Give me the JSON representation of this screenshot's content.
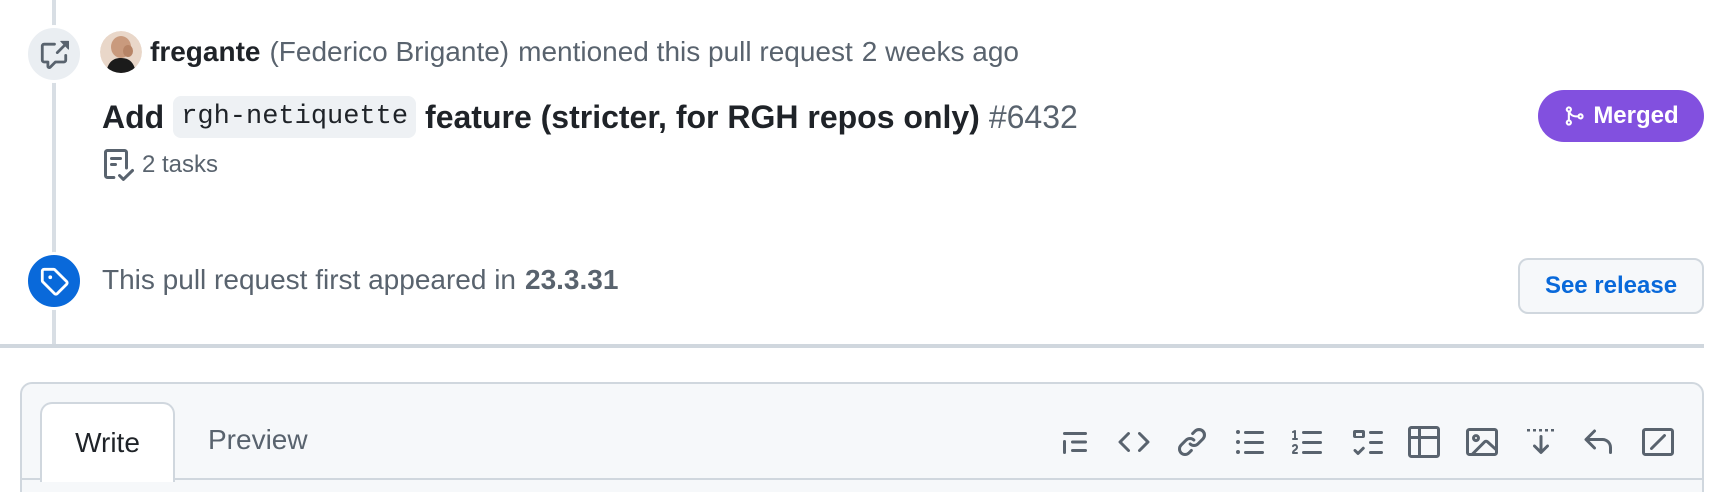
{
  "event": {
    "author": "fregante",
    "full_name": "(Federico Brigante)",
    "action": "mentioned this pull request",
    "time": "2 weeks ago"
  },
  "pull_request": {
    "title_prefix": "Add",
    "title_code": "rgh-netiquette",
    "title_suffix": "feature (stricter, for RGH repos only)",
    "number": "#6432",
    "tasks": "2 tasks",
    "state": "Merged"
  },
  "release": {
    "text": "This pull request first appeared in",
    "version": "23.3.31",
    "button": "See release"
  },
  "editor": {
    "tab_write": "Write",
    "tab_preview": "Preview",
    "toolbar_icons": [
      "heading-icon",
      "code-icon",
      "link-icon",
      "unordered-list-icon",
      "ordered-list-icon",
      "task-list-icon",
      "table-icon",
      "image-icon",
      "saved-replies-icon",
      "reply-icon",
      "fullscreen-icon"
    ]
  },
  "colors": {
    "merged": "#8250df",
    "release_badge": "#0969da",
    "link": "#0969da"
  }
}
